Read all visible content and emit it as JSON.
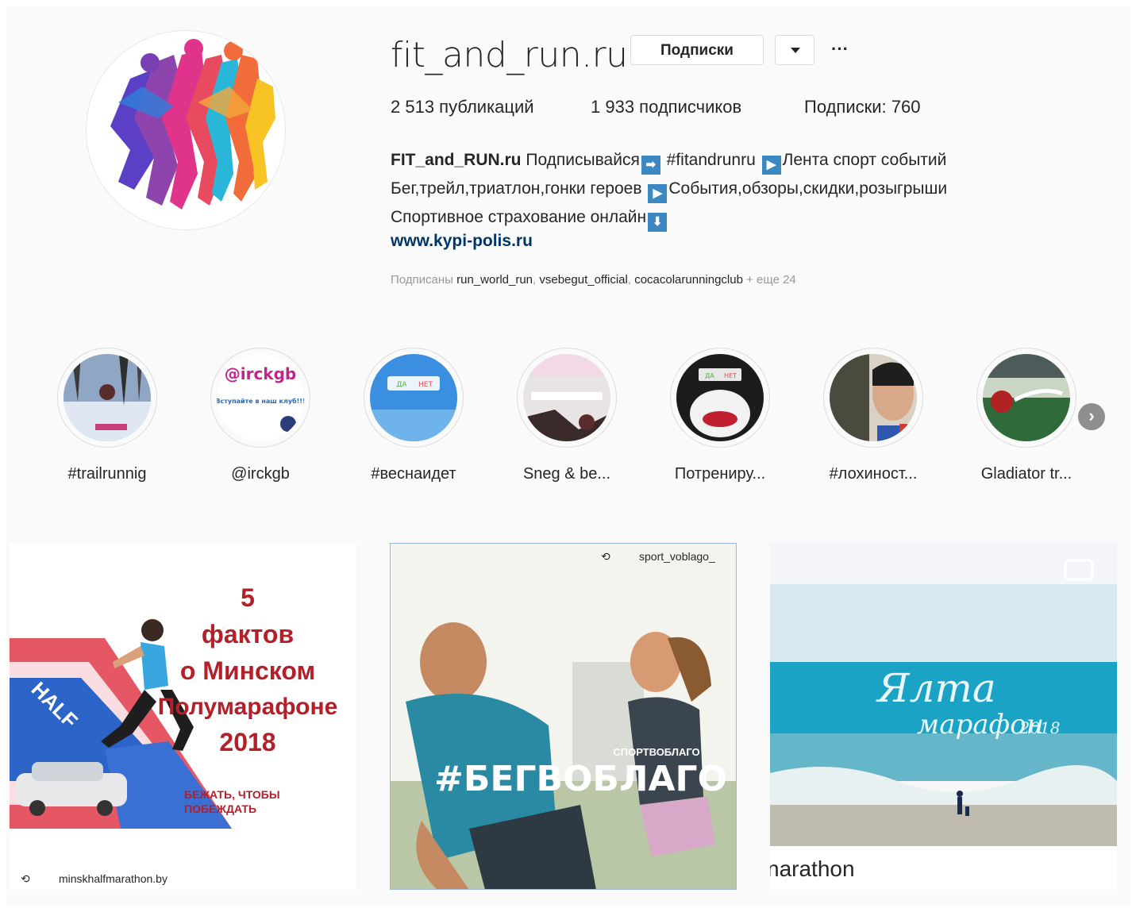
{
  "profile": {
    "username": "fit_and_run.ru",
    "follow_label": "Подписки",
    "more_label": "···",
    "stats": {
      "posts": "2 513 публикаций",
      "followers": "1 933 подписчиков",
      "following": "Подписки: 760"
    },
    "bio": {
      "name": "FIT_and_RUN.ru",
      "line1_a": "Подписывайся",
      "line1_b": "#fitandrunru",
      "line1_c": "Лента спорт событий",
      "line2_a": "Бег,трейл,триатлон,гонки героев",
      "line2_b": "События,обзоры,скидки,розыгрыши",
      "line3": "Спортивное страхование онлайн",
      "arrow_right": "➡",
      "arrow_play": "▶",
      "arrow_down": "⬇"
    },
    "link": "www.kypi-polis.ru",
    "followed_by": {
      "prefix": "Подписаны",
      "users": [
        "run_world_run",
        "vsebegut_official",
        "cocacolarunningclub"
      ],
      "more": "+ еще 24"
    }
  },
  "highlights": [
    {
      "label": "#trailrunnig"
    },
    {
      "label": "@irckgb",
      "inner_text": "@irckgb",
      "inner_sub": "Вступайте в наш клуб!!!"
    },
    {
      "label": "#веснаидет",
      "inner_yes": "ДА",
      "inner_no": "НЕТ"
    },
    {
      "label": "Sneg & be..."
    },
    {
      "label": "Потрениру...",
      "inner_yes": "ДА",
      "inner_no": "НЕТ"
    },
    {
      "label": "#лохиност..."
    },
    {
      "label": "Gladiator tr..."
    }
  ],
  "posts": [
    {
      "title_lines": [
        "5",
        "фактов",
        "о Минском",
        "Полумарафоне",
        "2018"
      ],
      "slogan": [
        "БЕЖАТЬ, ЧТОБЫ",
        "ПОБЕЖДАТЬ"
      ],
      "repost_user": "minskhalfmarathon.by",
      "half_text": "HALF"
    },
    {
      "repost_user": "sport_voblago_",
      "brand": "СПОРТВОБЛАГО",
      "hashtag": "#БЕГВОБЛАГО"
    },
    {
      "caption": "narathon",
      "logo_text": "Ялта",
      "logo_sub": "марафон",
      "year": "2018"
    }
  ],
  "colors": {
    "link": "#003569",
    "arrow_box": "#3b88c3",
    "post1_red": "#b3202a",
    "sea": "#1aa3c4"
  }
}
